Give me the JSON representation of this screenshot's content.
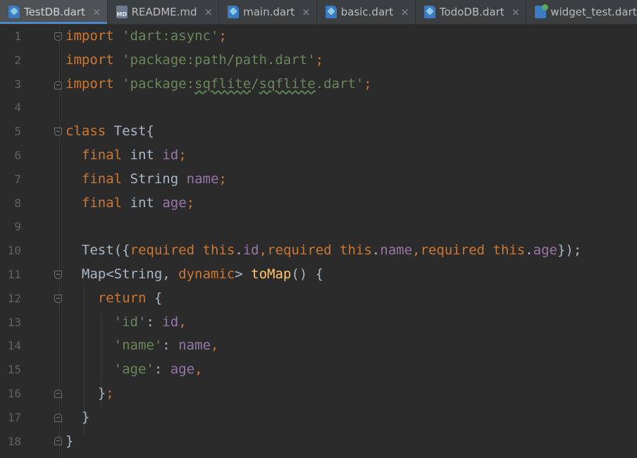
{
  "tabs": [
    {
      "label": "TestDB.dart",
      "icon": "dart-file-icon",
      "active": true
    },
    {
      "label": "README.md",
      "icon": "markdown-file-icon",
      "active": false
    },
    {
      "label": "main.dart",
      "icon": "dart-file-icon",
      "active": false
    },
    {
      "label": "basic.dart",
      "icon": "dart-file-icon",
      "active": false
    },
    {
      "label": "TodoDB.dart",
      "icon": "dart-file-icon",
      "active": false
    },
    {
      "label": "widget_test.dart",
      "icon": "dart-test-file-icon",
      "active": false
    }
  ],
  "close_glyph": "×",
  "line_numbers": [
    "1",
    "2",
    "3",
    "4",
    "5",
    "6",
    "7",
    "8",
    "9",
    "10",
    "11",
    "12",
    "13",
    "14",
    "15",
    "16",
    "17",
    "18"
  ],
  "code": {
    "import_kw": "import",
    "l1_str": "'dart:async'",
    "l2_str": "'package:path/path.dart'",
    "l3_pre": "'package:",
    "l3_sqflite_a": "sqflite",
    "l3_slash": "/",
    "l3_sqflite_b": "sqflite",
    "l3_post": ".dart'",
    "semi": ";",
    "class_kw": "class",
    "class_name": "Test{",
    "final_kw": "final",
    "int_type": "int",
    "string_type": "String",
    "id": "id",
    "name": "name",
    "age": "age",
    "ctor_open": "Test({",
    "required_kw": "required",
    "this_kw": "this",
    "dot": ".",
    "comma": ",",
    "ctor_close": "});",
    "map_type": "Map<String, ",
    "dynamic_kw": "dynamic",
    "gt": "> ",
    "tomap_fn": "toMap",
    "tomap_rest": "() {",
    "return_kw": "return",
    "open_brace": " {",
    "key_id": "'id'",
    "key_name": "'name'",
    "key_age": "'age'",
    "colon": ": ",
    "close_brace_semi": "}",
    "close_brace": "}"
  }
}
